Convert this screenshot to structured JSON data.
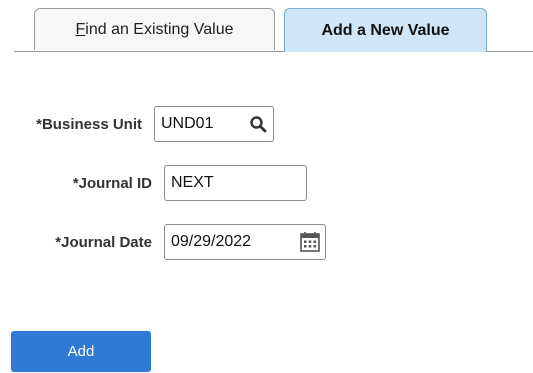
{
  "tabs": {
    "find_existing": {
      "mnemonic": "F",
      "rest": "ind an Existing Value"
    },
    "add_new": {
      "label": "Add a New Value",
      "active": true
    }
  },
  "form": {
    "business_unit": {
      "label": "*Business Unit",
      "value": "UND01",
      "icon": "search-icon"
    },
    "journal_id": {
      "label": "*Journal ID",
      "value": "NEXT"
    },
    "journal_date": {
      "label": "*Journal Date",
      "value": "09/29/2022",
      "icon": "calendar-icon"
    }
  },
  "actions": {
    "add_label": "Add"
  },
  "colors": {
    "active_tab_bg": "#cfe6f8",
    "inactive_tab_bg": "#f7f7f7",
    "primary_button": "#2f7ad4"
  }
}
